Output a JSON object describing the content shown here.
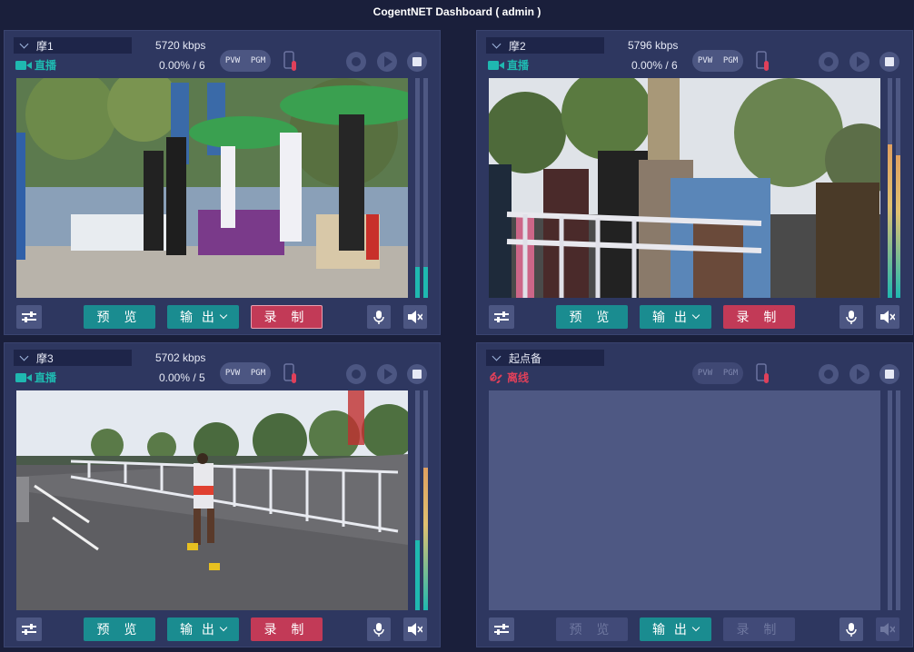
{
  "app": {
    "title": "CogentNET Dashboard ( admin )"
  },
  "labels": {
    "preview": "预 览",
    "output": "输 出",
    "record": "录 制",
    "pvw": "PVW",
    "pgm": "PGM"
  },
  "colors": {
    "live": "#1fb8b0",
    "offline": "#e0405a",
    "record": "#c23a57",
    "teal_button": "#1a8c90"
  },
  "panels": [
    {
      "name": "摩1",
      "bitrate": "5720 kbps",
      "status": "直播",
      "percent": "0.00% / 6",
      "meter_left": 0.14,
      "meter_right": 0.14,
      "recording": true
    },
    {
      "name": "摩2",
      "bitrate": "5796 kbps",
      "status": "直播",
      "percent": "0.00% / 6",
      "meter_left": 0.7,
      "meter_right": 0.65,
      "recording": false
    },
    {
      "name": "摩3",
      "bitrate": "5702 kbps",
      "status": "直播",
      "percent": "0.00% / 5",
      "meter_left": 0.32,
      "meter_right": 0.65,
      "recording": false
    },
    {
      "name": "起点备",
      "bitrate": "",
      "status": "离线",
      "percent": "",
      "meter_left": 0,
      "meter_right": 0,
      "recording": false
    }
  ]
}
